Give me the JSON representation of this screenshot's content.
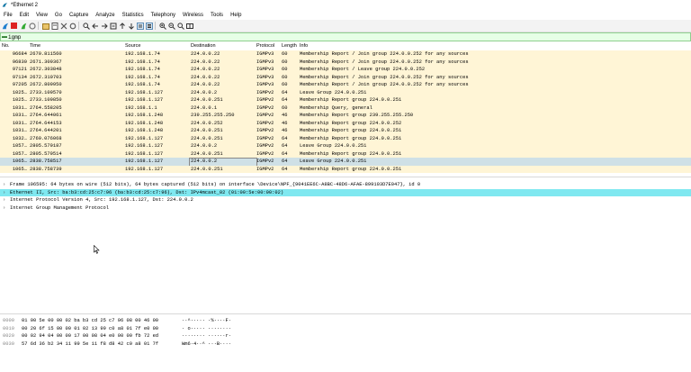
{
  "window": {
    "title": "*Ethernet 2"
  },
  "menu": [
    "File",
    "Edit",
    "View",
    "Go",
    "Capture",
    "Analyze",
    "Statistics",
    "Telephony",
    "Wireless",
    "Tools",
    "Help"
  ],
  "toolbar": {
    "icons": [
      "shark-fin-start-icon",
      "stop-capture-icon",
      "restart-capture-icon",
      "capture-options-icon",
      "open-file-icon",
      "save-file-icon",
      "close-file-icon",
      "reload-icon",
      "find-packet-icon",
      "go-back-icon",
      "go-forward-icon",
      "go-to-packet-icon",
      "go-first-icon",
      "go-last-icon",
      "auto-scroll-icon",
      "colorize-icon",
      "zoom-in-icon",
      "zoom-out-icon",
      "zoom-normal-icon",
      "resize-columns-icon"
    ]
  },
  "filter": {
    "value": "igmp"
  },
  "columns": {
    "no": "No.",
    "time": "Time",
    "source": "Source",
    "destination": "Destination",
    "protocol": "Protocol",
    "length": "Length",
    "info": "Info"
  },
  "packets": [
    {
      "no": "96684",
      "time": "2670.811560",
      "src": "192.168.1.74",
      "dst": "224.0.0.22",
      "proto": "IGMPv3",
      "len": "60",
      "info": "Membership Report / Join group 224.0.0.252 for any sources",
      "bg": "#fff5d6"
    },
    {
      "no": "96830",
      "time": "2671.309367",
      "src": "192.168.1.74",
      "dst": "224.0.0.22",
      "proto": "IGMPv3",
      "len": "60",
      "info": "Membership Report / Join group 224.0.0.252 for any sources",
      "bg": "#fff5d6"
    },
    {
      "no": "97121",
      "time": "2672.303848",
      "src": "192.168.1.74",
      "dst": "224.0.0.22",
      "proto": "IGMPv3",
      "len": "60",
      "info": "Membership Report / Leave group 224.0.0.252",
      "bg": "#fff5d6"
    },
    {
      "no": "97134",
      "time": "2672.310703",
      "src": "192.168.1.74",
      "dst": "224.0.0.22",
      "proto": "IGMPv3",
      "len": "60",
      "info": "Membership Report / Join group 224.0.0.252 for any sources",
      "bg": "#fff5d6"
    },
    {
      "no": "97205",
      "time": "2672.809950",
      "src": "192.168.1.74",
      "dst": "224.0.0.22",
      "proto": "IGMPv3",
      "len": "60",
      "info": "Membership Report / Join group 224.0.0.252 for any sources",
      "bg": "#fff5d6"
    },
    {
      "no": "1025…",
      "time": "2733.109570",
      "src": "192.168.1.127",
      "dst": "224.0.0.2",
      "proto": "IGMPv2",
      "len": "64",
      "info": "Leave Group 224.0.0.251",
      "bg": "#fff5d6"
    },
    {
      "no": "1025…",
      "time": "2733.109850",
      "src": "192.168.1.127",
      "dst": "224.0.0.251",
      "proto": "IGMPv2",
      "len": "64",
      "info": "Membership Report group 224.0.0.251",
      "bg": "#fff5d6"
    },
    {
      "no": "1031…",
      "time": "2764.558205",
      "src": "192.168.1.1",
      "dst": "224.0.0.1",
      "proto": "IGMPv2",
      "len": "60",
      "info": "Membership Query, general",
      "bg": "#fff5d6"
    },
    {
      "no": "1031…",
      "time": "2764.644061",
      "src": "192.168.1.248",
      "dst": "239.255.255.250",
      "proto": "IGMPv2",
      "len": "46",
      "info": "Membership Report group 239.255.255.250",
      "bg": "#fff5d6"
    },
    {
      "no": "1031…",
      "time": "2764.644153",
      "src": "192.168.1.248",
      "dst": "224.0.0.252",
      "proto": "IGMPv2",
      "len": "46",
      "info": "Membership Report group 224.0.0.252",
      "bg": "#fff5d6"
    },
    {
      "no": "1031…",
      "time": "2764.644201",
      "src": "192.168.1.248",
      "dst": "224.0.0.251",
      "proto": "IGMPv2",
      "len": "46",
      "info": "Membership Report group 224.0.0.251",
      "bg": "#fff5d6"
    },
    {
      "no": "1032…",
      "time": "2769.076068",
      "src": "192.168.1.127",
      "dst": "224.0.0.251",
      "proto": "IGMPv2",
      "len": "64",
      "info": "Membership Report group 224.0.0.251",
      "bg": "#fff5d6"
    },
    {
      "no": "1057…",
      "time": "2805.579187",
      "src": "192.168.1.127",
      "dst": "224.0.0.2",
      "proto": "IGMPv2",
      "len": "64",
      "info": "Leave Group 224.0.0.251",
      "bg": "#fff5d6"
    },
    {
      "no": "1057…",
      "time": "2805.579514",
      "src": "192.168.1.127",
      "dst": "224.0.0.251",
      "proto": "IGMPv2",
      "len": "64",
      "info": "Membership Report group 224.0.0.251",
      "bg": "#fff5d6"
    },
    {
      "no": "1065…",
      "time": "2838.758517",
      "src": "192.168.1.127",
      "dst": "224.0.0.2",
      "proto": "IGMPv2",
      "len": "64",
      "info": "Leave Group 224.0.0.251",
      "bg": "#cfe0e6"
    },
    {
      "no": "1065…",
      "time": "2838.758739",
      "src": "192.168.1.127",
      "dst": "224.0.0.251",
      "proto": "IGMPv2",
      "len": "64",
      "info": "Membership Report group 224.0.0.251",
      "bg": "#fff5d6"
    }
  ],
  "details": [
    {
      "text": "Frame 106595: 64 bytes on wire (512 bits), 64 bytes captured (512 bits) on interface \\Device\\NPF_{9041EE6C-A8BC-48D6-AFAE-899103D7E047}, id 0",
      "bg": "#ffffff"
    },
    {
      "text": "Ethernet II, Src: ba:b3:cd:25:c7:96 (ba:b3:cd:25:c7:96), Dst: IPv4mcast_02 (01:00:5e:00:00:02)",
      "bg": "#7fe8f0"
    },
    {
      "text": "Internet Protocol Version 4, Src: 192.168.1.127, Dst: 224.0.0.2",
      "bg": "#ffffff"
    },
    {
      "text": "Internet Group Management Protocol",
      "bg": "#ffffff"
    }
  ],
  "hexdump": [
    {
      "offset": "0000",
      "bytes": "01 00 5e 00 00 02 ba b3  cd 25 c7 96 08 00 46 00",
      "ascii": "··^·····  ·%····F·"
    },
    {
      "offset": "0010",
      "bytes": "00 20 6f 15 00 00 01 02  13 99 c0 a8 01 7f e0 00",
      "ascii": "· o·····  ········"
    },
    {
      "offset": "0020",
      "bytes": "00 02 94 04 00 00 17 00  08 04 e0 00 00 fb 72 ed",
      "ascii": "········  ······r·"
    },
    {
      "offset": "0030",
      "bytes": "57 6d 36 b2 34 11 99 5e  11 f8 d8 42 c0 a8 01 7f",
      "ascii": "Wm6·4··^  ···B····"
    }
  ],
  "colors": {
    "row_default": "#fff5d6",
    "row_selected": "#cfe0e6",
    "ethernet_highlight": "#7fe8f0",
    "filter_bg": "#e6ffe6"
  }
}
